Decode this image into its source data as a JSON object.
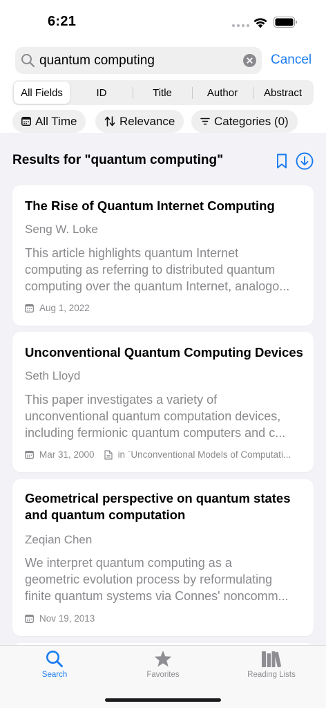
{
  "status": {
    "time": "6:21"
  },
  "search": {
    "query": "quantum computing",
    "cancel_label": "Cancel"
  },
  "fields": [
    "All Fields",
    "ID",
    "Title",
    "Author",
    "Abstract"
  ],
  "fields_selected": "All Fields",
  "filters": {
    "time": "All Time",
    "sort": "Relevance",
    "categories": "Categories (0)"
  },
  "results": {
    "heading": "Results for \"quantum computing\"",
    "items": [
      {
        "title": "The Rise of Quantum Internet Computing",
        "author": "Seng W. Loke",
        "abstract_lines": [
          "This article highlights quantum Internet",
          "computing as referring to distributed quantum",
          "computing over the quantum Internet, analogo..."
        ],
        "date": "Aug 1, 2022"
      },
      {
        "title": "Unconventional Quantum Computing Devices",
        "author": "Seth Lloyd",
        "abstract_lines": [
          "This paper investigates a variety of",
          "unconventional quantum computation devices,",
          "including fermionic quantum computers and c..."
        ],
        "date": "Mar 31, 2000",
        "venue": "in `Unconventional Models of Computati..."
      },
      {
        "title": "Geometrical perspective on quantum states and quantum computation",
        "author": "Zeqian Chen",
        "abstract_lines": [
          "We interpret quantum computing as a",
          "geometric evolution process by reformulating",
          "finite quantum systems via Connes' noncomm..."
        ],
        "date": "Nov 19, 2013"
      }
    ]
  },
  "tabs": [
    {
      "label": "Search",
      "icon": "search-icon",
      "active": true
    },
    {
      "label": "Favorites",
      "icon": "star-icon",
      "active": false
    },
    {
      "label": "Reading Lists",
      "icon": "books-icon",
      "active": false
    }
  ],
  "colors": {
    "accent": "#1a7cf0",
    "inactive": "#8e8e93",
    "background": "#f2f2f7"
  }
}
